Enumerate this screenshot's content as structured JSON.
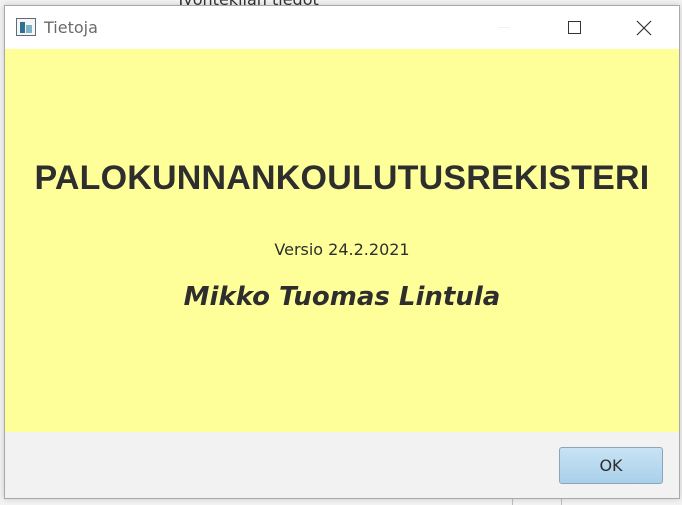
{
  "background_window": {
    "partial_text": "Työntekijän tiedot"
  },
  "dialog": {
    "title": "Tietoja",
    "heading": "PALOKUNNANKOULUTUSREKISTERI",
    "version": "Versio 24.2.2021",
    "author": "Mikko Tuomas Lintula",
    "ok_label": "OK",
    "colors": {
      "content_background": "#ffff99",
      "button_background": "#b8dbf1"
    }
  },
  "icons": {
    "app": "app-window-icon",
    "minimize": "minimize-icon",
    "maximize": "maximize-icon",
    "close": "close-icon"
  }
}
